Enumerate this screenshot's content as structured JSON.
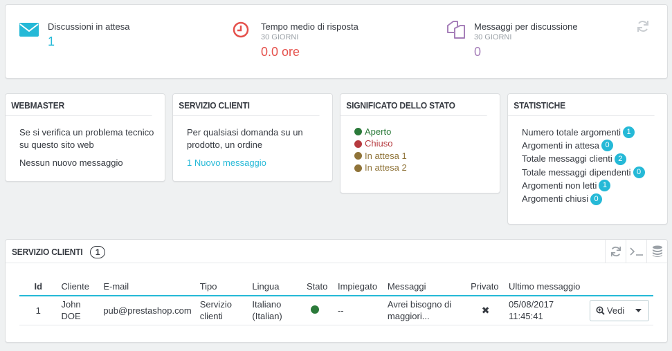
{
  "kpis": [
    {
      "title": "Discussioni in attesa",
      "sub": "",
      "value": "1",
      "value_color": "#25b9d7",
      "icon": "envelope-icon",
      "icon_color": "#25b9d7"
    },
    {
      "title": "Tempo medio di risposta",
      "sub": "30 giorni",
      "value": "0.0 ore",
      "value_color": "#e5514c",
      "icon": "clock-icon",
      "icon_color": "#e5514c"
    },
    {
      "title": "Messaggi per discussione",
      "sub": "30 giorni",
      "value": "0",
      "value_color": "#a67fb9",
      "icon": "copy-icon",
      "icon_color": "#a67fb9"
    }
  ],
  "webmaster": {
    "title": "Webmaster",
    "text": "Se si verifica un problema tecnico su questo sito web",
    "status": "Nessun nuovo messaggio"
  },
  "servizio": {
    "title": "Servizio clienti",
    "text": "Per qualsiasi domanda su un prodotto, un ordine",
    "link": "1 Nuovo messaggio"
  },
  "stato": {
    "title": "Significato dello stato",
    "items": [
      {
        "label": "Aperto",
        "color": "#2b7a3a"
      },
      {
        "label": "Chiuso",
        "color": "#b63a3f"
      },
      {
        "label": "In attesa 1",
        "color": "#8f7338"
      },
      {
        "label": "In attesa 2",
        "color": "#8f7338"
      }
    ]
  },
  "statistiche": {
    "title": "Statistiche",
    "rows": [
      {
        "label": "Numero totale argomenti",
        "value": "1"
      },
      {
        "label": "Argomenti in attesa",
        "value": "0"
      },
      {
        "label": "Totale messaggi clienti",
        "value": "2"
      },
      {
        "label": "Totale messaggi dipendenti",
        "value": "0"
      },
      {
        "label": "Argomenti non letti",
        "value": "1"
      },
      {
        "label": "Argomenti chiusi",
        "value": "0"
      }
    ]
  },
  "table": {
    "title": "Servizio clienti",
    "count": "1",
    "columns": [
      "Id",
      "Cliente",
      "E-mail",
      "Tipo",
      "Lingua",
      "Stato",
      "Impiegato",
      "Messaggi",
      "Privato",
      "Ultimo messaggio"
    ],
    "rows": [
      {
        "id": "1",
        "cliente": "John DOE",
        "email": "pub@prestashop.com",
        "tipo": "Servizio clienti",
        "lingua": "Italiano (Italian)",
        "stato_color": "#2b7a3a",
        "impiegato": "--",
        "messaggi": "Avrei bisogno di maggiori...",
        "privato": "✖",
        "ultimo": "05/08/2017 11:45:41",
        "action": "Vedi"
      }
    ]
  }
}
